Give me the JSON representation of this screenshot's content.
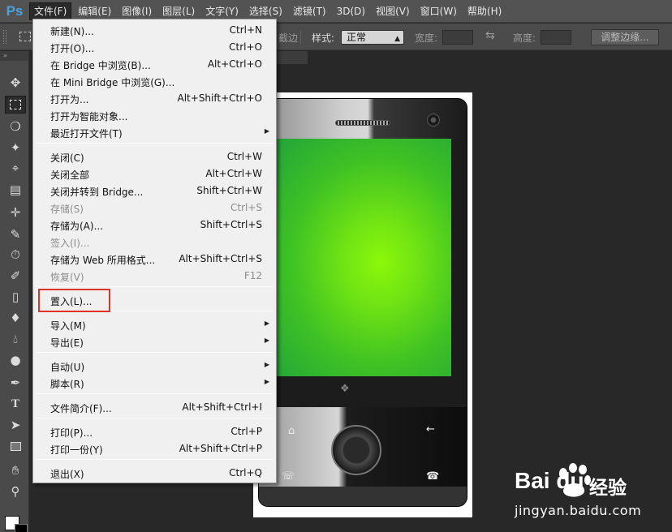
{
  "app": {
    "logo": "Ps",
    "menubar": [
      "文件(F)",
      "编辑(E)",
      "图像(I)",
      "图层(L)",
      "文字(Y)",
      "选择(S)",
      "滤镜(T)",
      "3D(D)",
      "视图(V)",
      "窗口(W)",
      "帮助(H)"
    ],
    "active_menu_index": 0
  },
  "options_bar": {
    "partial_label": "截边",
    "style_label": "样式:",
    "style_value": "正常",
    "width_label": "宽度:",
    "height_label": "高度:",
    "refine_edge_button": "调整边缘..."
  },
  "tools": [
    "move-icon",
    "rectangular-marquee-icon",
    "lasso-icon",
    "magic-wand-icon",
    "crop-icon",
    "eyedropper-icon",
    "spot-healing-icon",
    "brush-icon",
    "clone-stamp-icon",
    "history-brush-icon",
    "eraser-icon",
    "paint-bucket-icon",
    "blur-icon",
    "dodge-icon",
    "pen-icon",
    "type-icon",
    "path-selection-icon",
    "rectangle-shape-icon",
    "hand-icon",
    "zoom-icon"
  ],
  "file_menu": {
    "groups": [
      [
        {
          "label": "新建(N)...",
          "shortcut": "Ctrl+N"
        },
        {
          "label": "打开(O)...",
          "shortcut": "Ctrl+O"
        },
        {
          "label": "在 Bridge 中浏览(B)...",
          "shortcut": "Alt+Ctrl+O"
        },
        {
          "label": "在 Mini Bridge 中浏览(G)...",
          "shortcut": ""
        },
        {
          "label": "打开为...",
          "shortcut": "Alt+Shift+Ctrl+O"
        },
        {
          "label": "打开为智能对象...",
          "shortcut": ""
        },
        {
          "label": "最近打开文件(T)",
          "shortcut": "",
          "submenu": true
        }
      ],
      [
        {
          "label": "关闭(C)",
          "shortcut": "Ctrl+W"
        },
        {
          "label": "关闭全部",
          "shortcut": "Alt+Ctrl+W"
        },
        {
          "label": "关闭并转到 Bridge...",
          "shortcut": "Shift+Ctrl+W"
        },
        {
          "label": "存储(S)",
          "shortcut": "Ctrl+S",
          "disabled": true
        },
        {
          "label": "存储为(A)...",
          "shortcut": "Shift+Ctrl+S"
        },
        {
          "label": "签入(I)...",
          "shortcut": "",
          "disabled": true
        },
        {
          "label": "存储为 Web 所用格式...",
          "shortcut": "Alt+Shift+Ctrl+S"
        },
        {
          "label": "恢复(V)",
          "shortcut": "F12",
          "disabled": true
        }
      ],
      [
        {
          "label": "置入(L)...",
          "shortcut": "",
          "highlighted": true
        }
      ],
      [
        {
          "label": "导入(M)",
          "shortcut": "",
          "submenu": true
        },
        {
          "label": "导出(E)",
          "shortcut": "",
          "submenu": true
        }
      ],
      [
        {
          "label": "自动(U)",
          "shortcut": "",
          "submenu": true
        },
        {
          "label": "脚本(R)",
          "shortcut": "",
          "submenu": true
        }
      ],
      [
        {
          "label": "文件简介(F)...",
          "shortcut": "Alt+Shift+Ctrl+I"
        }
      ],
      [
        {
          "label": "打印(P)...",
          "shortcut": "Ctrl+P"
        },
        {
          "label": "打印一份(Y)",
          "shortcut": "Alt+Shift+Ctrl+P"
        }
      ],
      [
        {
          "label": "退出(X)",
          "shortcut": "Ctrl+Q"
        }
      ]
    ]
  },
  "watermark": {
    "brand": "Bai  du",
    "tag": "经验",
    "url": "jingyan.baidu.com"
  },
  "colors": {
    "highlight_border": "#e03228",
    "ps_logo": "#4aa3df",
    "screen_center": "#8cf80a",
    "screen_edge": "#21a43b"
  }
}
